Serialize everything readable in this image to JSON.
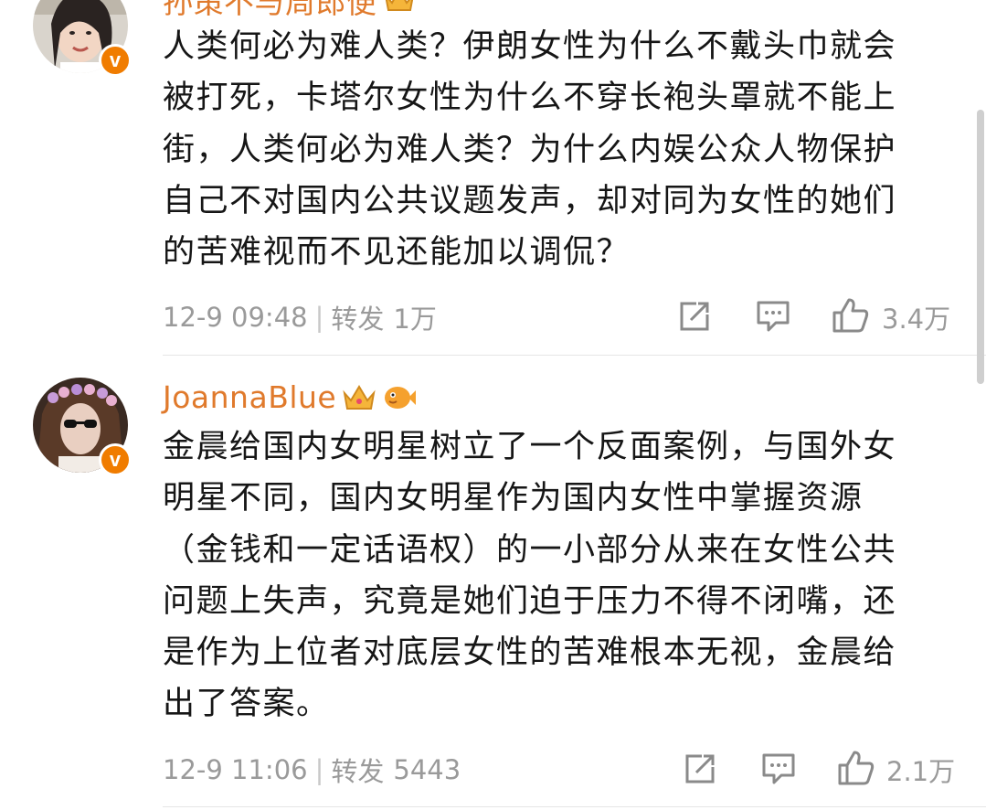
{
  "comments": [
    {
      "username": "孙策不与周郎便",
      "body_lines": [
        "人类何必为难人类？伊朗女性为什么不戴头巾就会",
        "被打死，卡塔尔女性为什么不穿长袍头罩就不能上",
        "街，人类何必为难人类？为什么内娱公众人物保护",
        "自己不对国内公共议题发声，却对同为女性的她们",
        "的苦难视而不见还能加以调侃？"
      ],
      "timestamp": "12-9 09:48",
      "repost_label": "转发",
      "repost_count": "1万",
      "like_count": "3.4万",
      "verified_badge": "v"
    },
    {
      "username": "JoannaBlue",
      "body_lines": [
        "金晨给国内女明星树立了一个反面案例，与国外女",
        "明星不同，国内女明星作为国内女性中掌握资源",
        "（金钱和一定话语权）的一小部分从来在女性公共",
        "问题上失声，究竟是她们迫于压力不得不闭嘴，还",
        "是作为上位者对底层女性的苦难根本无视，金晨给",
        "出了答案。"
      ],
      "timestamp": "12-9 11:06",
      "repost_label": "转发",
      "repost_count": "5443",
      "like_count": "2.1万",
      "verified_badge": "v"
    }
  ],
  "meta_separator": "|",
  "icons": {
    "share": "share-icon",
    "comment": "comment-icon",
    "like": "like-icon",
    "crown": "crown-badge-icon",
    "fish": "fish-badge-icon"
  },
  "colors": {
    "username": "#e07a2c",
    "body": "#161616",
    "meta": "#9a9a9a",
    "verified": "#f07c00"
  }
}
